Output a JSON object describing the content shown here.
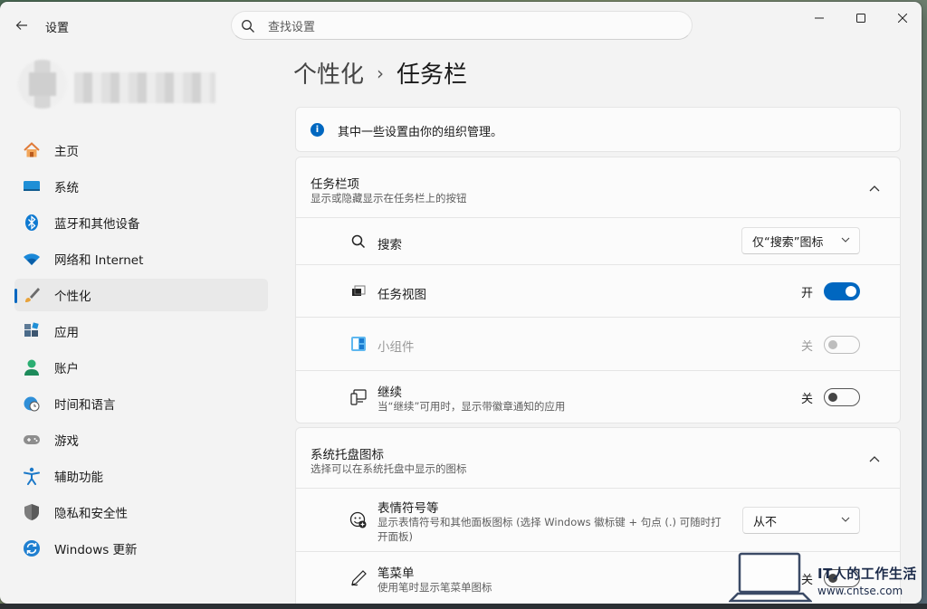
{
  "window": {
    "title": "设置",
    "controls": [
      "minimize",
      "maximize",
      "close"
    ]
  },
  "search": {
    "placeholder": "查找设置"
  },
  "sidebar": {
    "items": [
      {
        "label": "主页",
        "icon": "home-icon",
        "active": false
      },
      {
        "label": "系统",
        "icon": "system-icon",
        "active": false
      },
      {
        "label": "蓝牙和其他设备",
        "icon": "bluetooth-icon",
        "active": false
      },
      {
        "label": "网络和 Internet",
        "icon": "wifi-icon",
        "active": false
      },
      {
        "label": "个性化",
        "icon": "brush-icon",
        "active": true
      },
      {
        "label": "应用",
        "icon": "apps-icon",
        "active": false
      },
      {
        "label": "账户",
        "icon": "account-icon",
        "active": false
      },
      {
        "label": "时间和语言",
        "icon": "globe-clock-icon",
        "active": false
      },
      {
        "label": "游戏",
        "icon": "gamepad-icon",
        "active": false
      },
      {
        "label": "辅助功能",
        "icon": "accessibility-icon",
        "active": false
      },
      {
        "label": "隐私和安全性",
        "icon": "shield-icon",
        "active": false
      },
      {
        "label": "Windows 更新",
        "icon": "update-icon",
        "active": false
      }
    ]
  },
  "breadcrumb": {
    "parent": "个性化",
    "separator": "›",
    "current": "任务栏"
  },
  "notice": {
    "text": "其中一些设置由你的组织管理。"
  },
  "taskbar_items": {
    "title": "任务栏项",
    "subtitle": "显示或隐藏显示在任务栏上的按钮",
    "rows": {
      "search": {
        "title": "搜索",
        "dropdown": "仅“搜索”图标"
      },
      "taskview": {
        "title": "任务视图",
        "state_label": "开"
      },
      "widgets": {
        "title": "小组件",
        "state_label": "关"
      },
      "continue": {
        "title": "继续",
        "subtitle": "当“继续”可用时，显示带徽章通知的应用",
        "state_label": "关"
      }
    }
  },
  "tray_icons": {
    "title": "系统托盘图标",
    "subtitle": "选择可以在系统托盘中显示的图标",
    "rows": {
      "emoji": {
        "title": "表情符号等",
        "subtitle1": "显示表情符号和其他面板图标 (选择 Windows 徽标键 + 句点 (.) 可随时打",
        "subtitle2": "开面板)",
        "dropdown": "从不"
      },
      "pen": {
        "title": "笔菜单",
        "subtitle": "使用笔时显示笔菜单图标",
        "state_label": "关"
      }
    }
  },
  "watermark": {
    "text": "IT人的工作生活",
    "url": "www.cntse.com"
  },
  "colors": {
    "accent": "#0067c0",
    "window_bg": "#f3f3f3",
    "card_bg": "#fbfbfb"
  }
}
